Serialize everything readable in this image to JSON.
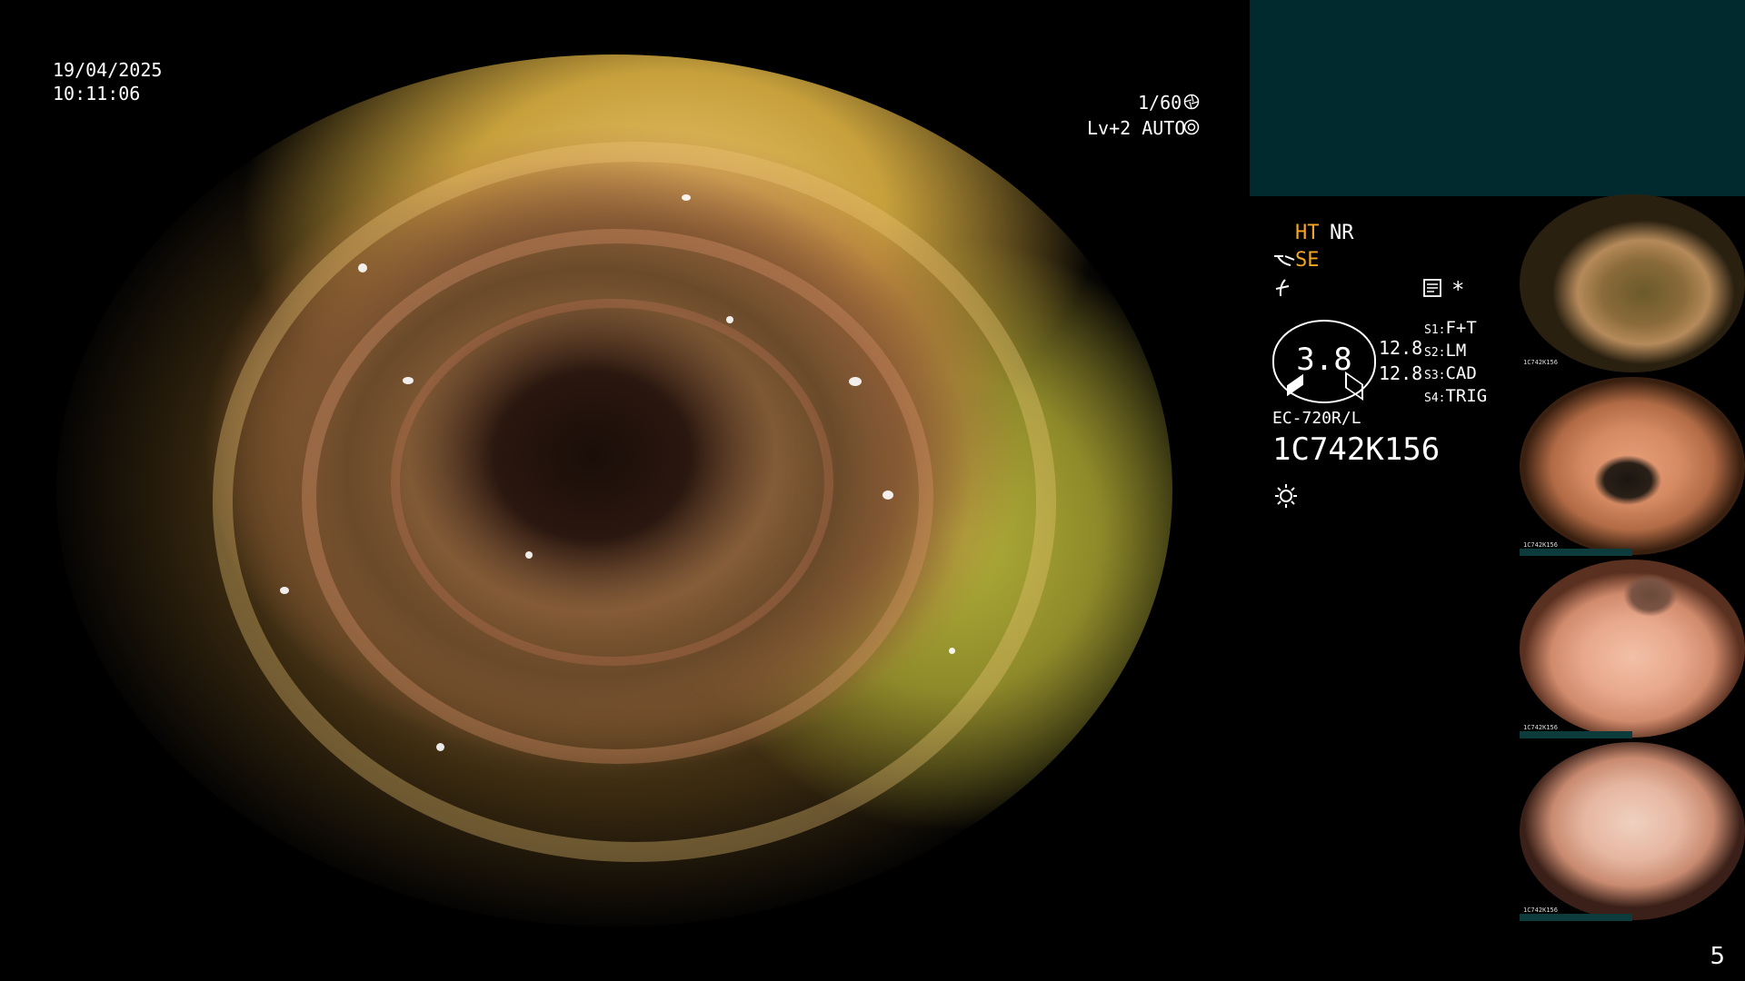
{
  "timestamp": {
    "date": "19/04/2025",
    "time": "10:11:06"
  },
  "camera": {
    "shutter": "1/60",
    "exposure": "Lv+2 AUTO"
  },
  "modes": {
    "ht": "HT",
    "nr": "NR",
    "se": "SE",
    "asterisk": "*"
  },
  "dial": {
    "value": "3.8",
    "side_top": "12.8",
    "side_bottom": "12.8"
  },
  "switches": [
    {
      "key": "S1",
      "label": "F+T"
    },
    {
      "key": "S2",
      "label": "LM"
    },
    {
      "key": "S3",
      "label": "CAD"
    },
    {
      "key": "S4",
      "label": "TRIG"
    }
  ],
  "scope": {
    "model": "EC-720R/L",
    "serial": "1C742K156"
  },
  "thumbnails": [
    {
      "caption": "1C742K156"
    },
    {
      "caption": "1C742K156"
    },
    {
      "caption": "1C742K156"
    },
    {
      "caption": "1C742K156"
    }
  ],
  "page_number": "5",
  "icons": {
    "shutter": "aperture-icon",
    "exposure": "auto-iris-icon",
    "scope_symbol": "scope-hook-icon",
    "flash": "flash-icon",
    "report": "report-icon",
    "light": "light-sun-icon"
  },
  "colors": {
    "accent": "#f5a623",
    "panel": "#002a2e"
  }
}
